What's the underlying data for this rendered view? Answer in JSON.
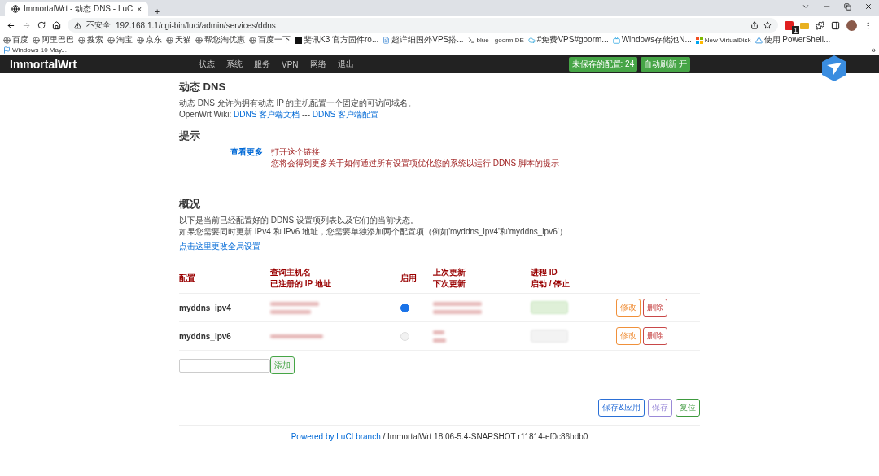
{
  "browser": {
    "tab_title": "ImmortalWrt - 动态 DNS - LuC",
    "tab_close": "×",
    "new_tab": "+",
    "security": "不安全",
    "url": "192.168.1.1/cgi-bin/luci/admin/services/ddns",
    "extension_badge": "1",
    "bookmarks": [
      {
        "label": "百度",
        "kind": "globe"
      },
      {
        "label": "阿里巴巴",
        "kind": "globe"
      },
      {
        "label": "搜索",
        "kind": "globe"
      },
      {
        "label": "淘宝",
        "kind": "globe"
      },
      {
        "label": "京东",
        "kind": "globe"
      },
      {
        "label": "天猫",
        "kind": "globe"
      },
      {
        "label": "帮您淘优惠",
        "kind": "globe"
      },
      {
        "label": "百度一下",
        "kind": "globe"
      },
      {
        "label": "斐讯K3 官方固件ro...",
        "kind": "square"
      },
      {
        "label": "超详细国外VPS搭...",
        "kind": "doc"
      },
      {
        "label": "blue - goormIDE",
        "kind": "terminal"
      },
      {
        "label": "#免费VPS#goorm...",
        "kind": "cloud"
      },
      {
        "label": "Windows存储池N...",
        "kind": "tv"
      },
      {
        "label": "New-VirtualDisk",
        "kind": "tiles"
      },
      {
        "label": "使用 PowerShell...",
        "kind": "triangle"
      },
      {
        "label": "Windows 10 May...",
        "kind": "flag"
      }
    ],
    "more": "»"
  },
  "header": {
    "brand": "ImmortalWrt",
    "menu": [
      "状态",
      "系统",
      "服务",
      "VPN",
      "网络",
      "退出"
    ],
    "unsaved": "未保存的配置: 24",
    "autorefresh": "自动刷新 开"
  },
  "page": {
    "title": "动态 DNS",
    "description": "动态 DNS 允许为拥有动态 IP 的主机配置一个固定的可访问域名。",
    "wiki_label": "OpenWrt Wiki:",
    "wiki_links": [
      "DDNS 客户端文档",
      "DDNS 客户端配置"
    ],
    "wiki_separator": "---",
    "hints": {
      "title": "提示",
      "more": "查看更多",
      "link": "打开这个链接",
      "text": "您将会得到更多关于如何通过所有设置项优化您的系统以运行 DDNS 脚本的提示"
    },
    "overview": {
      "title": "概况",
      "lines": [
        "以下是当前已经配置好的 DDNS 设置项列表以及它们的当前状态。",
        "如果您需要同时更新 IPv4 和 IPv6 地址，您需要单独添加两个配置项（例如'myddns_ipv4'和'myddns_ipv6'）"
      ],
      "global_link": "点击这里更改全局设置",
      "columns": [
        [
          "配置"
        ],
        [
          "查询主机名",
          "已注册的 IP 地址"
        ],
        [
          "启用"
        ],
        [
          "上次更新",
          "下次更新"
        ],
        [
          "进程 ID",
          "启动 / 停止"
        ]
      ],
      "rows": [
        {
          "name": "myddns_ipv4",
          "enabled": true,
          "running": true,
          "edit": "修改",
          "delete": "删除"
        },
        {
          "name": "myddns_ipv6",
          "enabled": false,
          "running": false,
          "edit": "修改",
          "delete": "删除"
        }
      ],
      "add": "添加"
    },
    "buttons": [
      {
        "label": "保存&应用",
        "kind": "apply"
      },
      {
        "label": "保存",
        "kind": "save"
      },
      {
        "label": "复位",
        "kind": "reset"
      }
    ],
    "footer_link": "Powered by LuCI branch",
    "footer_text": "/ ImmortalWrt 18.06-5.4-SNAPSHOT r11814-ef0c86bdb0"
  }
}
